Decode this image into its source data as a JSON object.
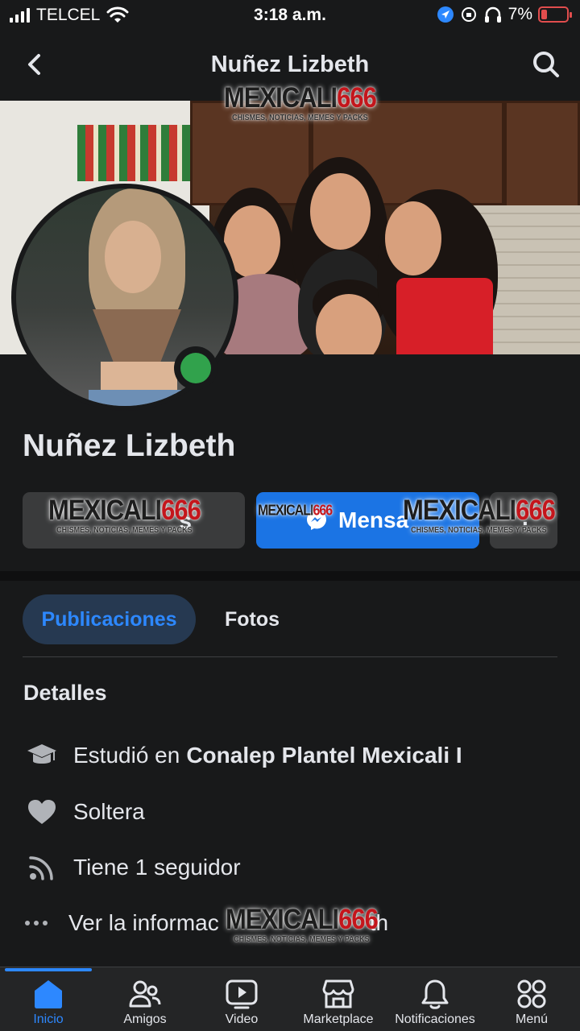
{
  "status_bar": {
    "carrier": "TELCEL",
    "time": "3:18 a.m.",
    "battery": "7%",
    "battery_level": 0.07
  },
  "nav": {
    "title": "Nuñez Lizbeth",
    "back_icon": "chevron-left-icon",
    "search_icon": "search-icon"
  },
  "profile": {
    "name": "Nuñez Lizbeth",
    "online": true
  },
  "actions": {
    "friends_partial": "s",
    "message_partial": "Mensa",
    "more_partial": "."
  },
  "watermark": {
    "main": "MEXICALI",
    "number": "666",
    "tagline": "CHISMES, NOTICIAS, MEMES Y PACKS"
  },
  "tabs": [
    {
      "label": "Publicaciones",
      "active": true
    },
    {
      "label": "Fotos",
      "active": false
    }
  ],
  "details": {
    "title": "Detalles",
    "education_prefix": "Estudió en",
    "education_school": "Conalep Plantel Mexicali I",
    "relationship": "Soltera",
    "followers": "Tiene 1 seguidor",
    "more_info_start": "Ver la informac",
    "more_info_end": "th"
  },
  "bottom_nav": [
    {
      "label": "Inicio",
      "icon": "home-icon",
      "active": true
    },
    {
      "label": "Amigos",
      "icon": "friends-icon",
      "active": false
    },
    {
      "label": "Video",
      "icon": "video-icon",
      "active": false
    },
    {
      "label": "Marketplace",
      "icon": "marketplace-icon",
      "active": false
    },
    {
      "label": "Notificaciones",
      "icon": "bell-icon",
      "active": false
    },
    {
      "label": "Menú",
      "icon": "menu-grid-icon",
      "active": false
    }
  ],
  "colors": {
    "background": "#18191a",
    "accent": "#2d88ff",
    "message_button": "#1b74e4",
    "online": "#31a24c",
    "battery_low": "#e14d4d"
  }
}
